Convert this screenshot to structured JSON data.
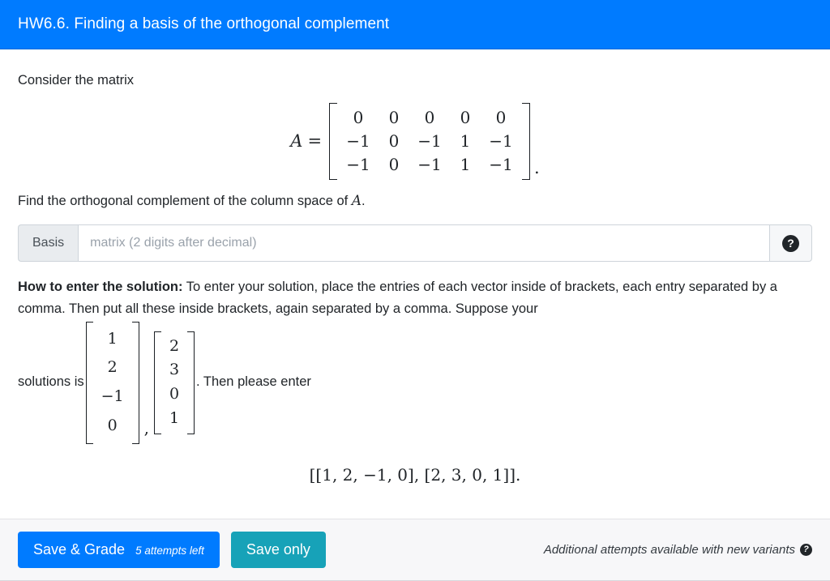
{
  "header": {
    "title": "HW6.6. Finding a basis of the orthogonal complement",
    "bg_color": "#007bff"
  },
  "body": {
    "intro": "Consider the matrix",
    "matrix": {
      "name": "A",
      "equals": "=",
      "trailing_period": ".",
      "rows": [
        [
          "0",
          "0",
          "0",
          "0",
          "0"
        ],
        [
          "−1",
          "0",
          "−1",
          "1",
          "−1"
        ],
        [
          "−1",
          "0",
          "−1",
          "1",
          "−1"
        ]
      ]
    },
    "question_prefix": "Find the orthogonal complement of the column space of ",
    "question_symbol": "A",
    "question_suffix": ".",
    "answer": {
      "label": "Basis",
      "placeholder": "matrix (2 digits after decimal)",
      "value": "",
      "help_icon": "question-circle-icon"
    },
    "howto": {
      "heading": "How to enter the solution:",
      "text_1": " To enter your solution, place the entries of each vector inside of brackets, each entry separated by a comma. Then put all these inside brackets, again separated by a comma. Suppose your",
      "text_before_vectors": "solutions is",
      "vector_1": [
        "1",
        "2",
        "−1",
        "0"
      ],
      "vector_separator": ",",
      "vector_2": [
        "2",
        "3",
        "0",
        "1"
      ],
      "text_after_vectors": ". Then please enter",
      "example_answer": "[[1, 2, −1, 0], [2, 3, 0, 1]]."
    }
  },
  "footer": {
    "save_grade_label": "Save & Grade",
    "attempts_text": "5 attempts left",
    "save_only_label": "Save only",
    "note": "Additional attempts available with new variants",
    "note_help_icon": "question-circle-icon",
    "primary_color": "#007bff",
    "info_color": "#17a2b8"
  }
}
